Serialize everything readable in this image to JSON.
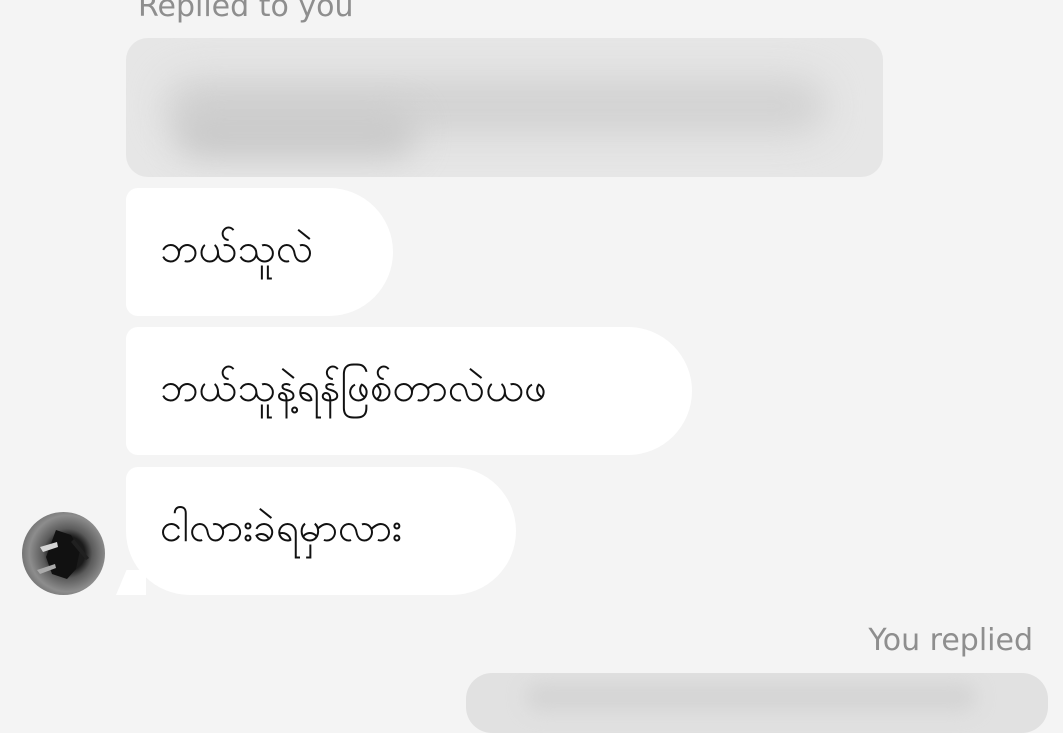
{
  "thread": {
    "replied_to_you_label": "Replied to you",
    "you_replied_label": "You replied"
  },
  "messages": [
    {
      "text": "ဘယ်သူလဲ"
    },
    {
      "text": "ဘယ်သူနဲ့ရန်ဖြစ်တာလဲယဖ"
    },
    {
      "text": "ငါလားခဲရမှာလား"
    }
  ],
  "colors": {
    "background": "#f4f4f4",
    "incoming_bubble": "#ffffff",
    "quoted_bubble": "#e6e6e6",
    "outgoing_bubble": "#e1e1e1",
    "label_text": "#8e8e8e",
    "message_text": "#111111"
  }
}
